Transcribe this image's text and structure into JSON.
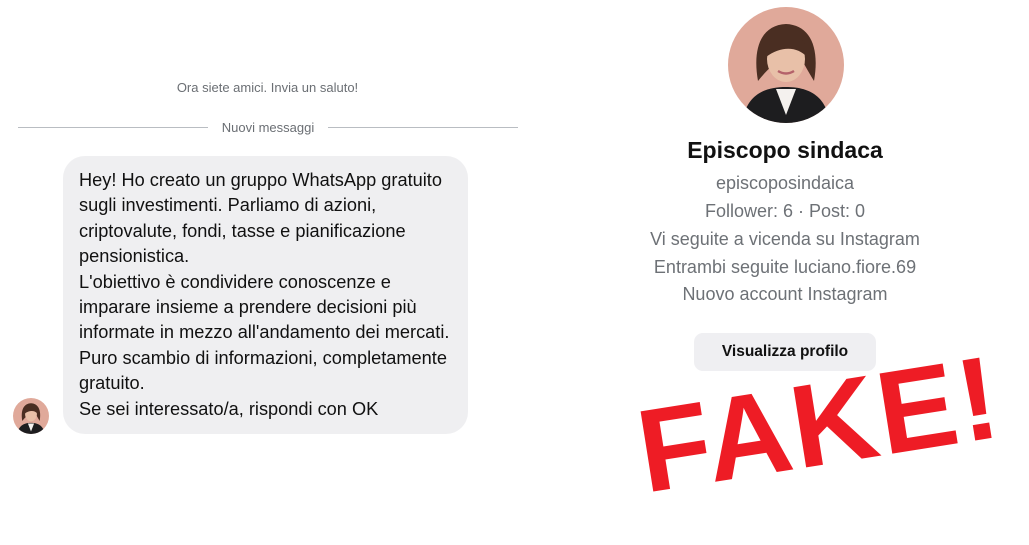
{
  "chat": {
    "system_note": "Ora siete amici. Invia un saluto!",
    "divider_label": "Nuovi messaggi",
    "message_paragraphs": [
      "Hey! Ho creato un gruppo WhatsApp gratuito sugli investimenti. Parliamo di azioni, criptovalute, fondi, tasse e pianificazione pensionistica.",
      "L'obiettivo è condividere conoscenze e imparare insieme a prendere decisioni più informate in mezzo all'andamento dei mercati. Puro scambio di informazioni, completamente gratuito.",
      "Se sei interessato/a, rispondi con OK"
    ]
  },
  "profile": {
    "name": "Episcopo sindaca",
    "username": "episcoposindaica",
    "stats": "Follower: 6 · Post: 0",
    "mutual_follow": "Vi seguite a vicenda su Instagram",
    "common_follow": "Entrambi seguite luciano.fiore.69",
    "account_note": "Nuovo account Instagram",
    "view_profile_label": "Visualizza profilo"
  },
  "overlay": {
    "stamp_text": "FAKE!"
  },
  "colors": {
    "bubble_bg": "#efeff1",
    "avatar_bg": "#e0a99a",
    "stamp_red": "#ee1c25"
  }
}
